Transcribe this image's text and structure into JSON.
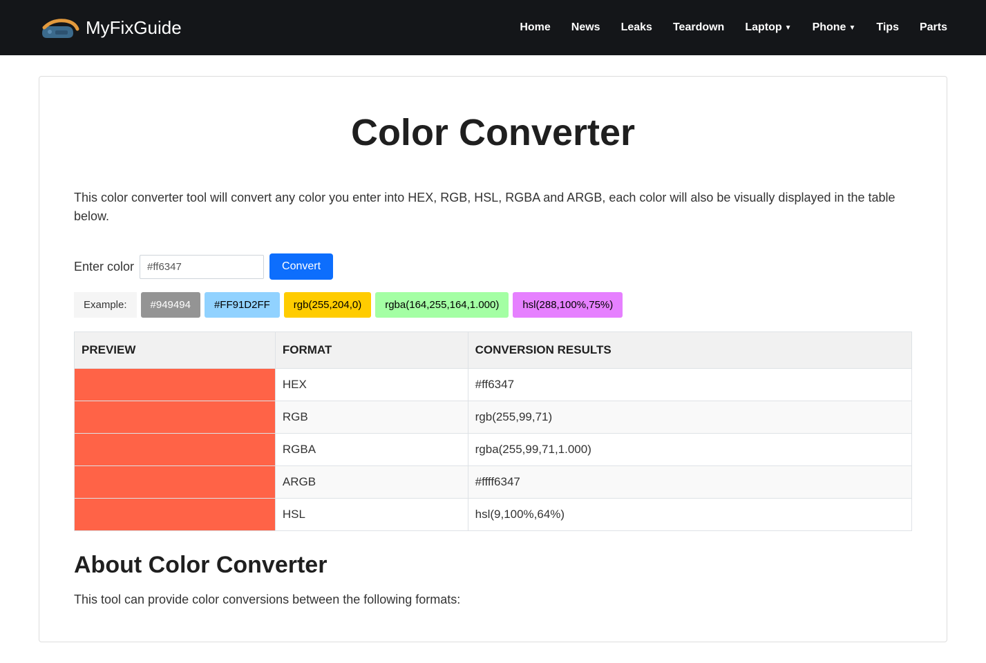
{
  "brand": "MyFixGuide",
  "nav": {
    "items": [
      {
        "label": "Home",
        "dropdown": false
      },
      {
        "label": "News",
        "dropdown": false
      },
      {
        "label": "Leaks",
        "dropdown": false
      },
      {
        "label": "Teardown",
        "dropdown": false
      },
      {
        "label": "Laptop",
        "dropdown": true
      },
      {
        "label": "Phone",
        "dropdown": true
      },
      {
        "label": "Tips",
        "dropdown": false
      },
      {
        "label": "Parts",
        "dropdown": false
      }
    ]
  },
  "page": {
    "title": "Color Converter",
    "description": "This color converter tool will convert any color you enter into HEX, RGB, HSL, RGBA and ARGB, each color will also be visually displayed in the table below.",
    "input_label": "Enter color",
    "input_value": "#ff6347",
    "convert_label": "Convert",
    "example_label": "Example:",
    "examples": [
      {
        "text": "#949494",
        "bg": "#949494",
        "fg": "#fff"
      },
      {
        "text": "#FF91D2FF",
        "bg": "#91D2FF",
        "fg": "#000"
      },
      {
        "text": "rgb(255,204,0)",
        "bg": "#ffcc00",
        "fg": "#000"
      },
      {
        "text": "rgba(164,255,164,1.000)",
        "bg": "#a4ffa4",
        "fg": "#000"
      },
      {
        "text": "hsl(288,100%,75%)",
        "bg": "#e680ff",
        "fg": "#000"
      }
    ],
    "table": {
      "headers": [
        "PREVIEW",
        "FORMAT",
        "CONVERSION RESULTS"
      ],
      "preview_color": "#ff6347",
      "rows": [
        {
          "format": "HEX",
          "result": "#ff6347"
        },
        {
          "format": "RGB",
          "result": "rgb(255,99,71)"
        },
        {
          "format": "RGBA",
          "result": "rgba(255,99,71,1.000)"
        },
        {
          "format": "ARGB",
          "result": "#ffff6347"
        },
        {
          "format": "HSL",
          "result": "hsl(9,100%,64%)"
        }
      ]
    },
    "about_title": "About Color Converter",
    "about_text": "This tool can provide color conversions between the following formats:"
  }
}
